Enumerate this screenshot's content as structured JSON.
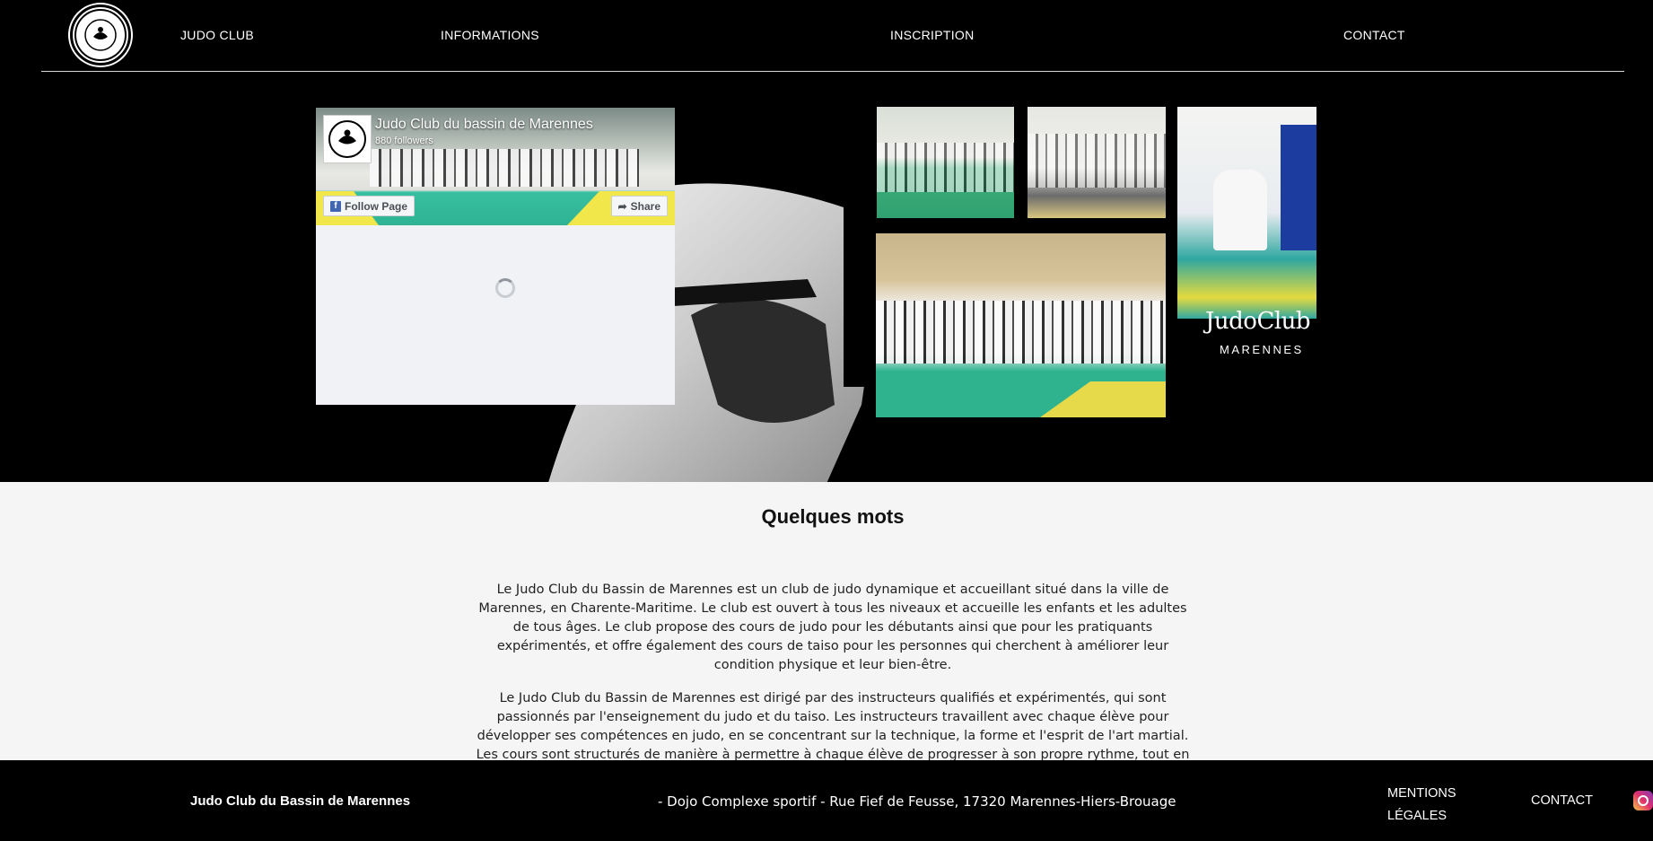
{
  "nav": {
    "items": [
      "JUDO CLUB",
      "INFORMATIONS",
      "INSCRIPTION",
      "CONTACT"
    ]
  },
  "facebook": {
    "page_name": "Judo Club du bassin de Marennes",
    "followers": "880 followers",
    "follow_label": "Follow Page",
    "share_label": "Share"
  },
  "brand": {
    "name": "JudoClub",
    "sub": "MARENNES"
  },
  "about": {
    "title": "Quelques mots",
    "paragraphs": [
      "Le Judo Club du Bassin de Marennes est un club de judo dynamique et accueillant situé dans la ville de Marennes, en Charente-Maritime. Le club est ouvert à tous les niveaux et accueille les enfants et les adultes de tous âges. Le club propose des cours de judo pour les débutants ainsi que pour les pratiquants expérimentés, et offre également des cours de taiso pour les personnes qui cherchent à améliorer leur condition physique et leur bien-être.",
      "Le Judo Club du Bassin de Marennes est dirigé par des instructeurs qualifiés et expérimentés, qui sont passionnés par l'enseignement du judo et du taiso. Les instructeurs travaillent avec chaque élève pour développer ses compétences en judo, en se concentrant sur la technique, la forme et l'esprit de l'art martial. Les cours sont structurés de manière à permettre à chaque élève de progresser à son propre rythme, tout en travaillant en"
    ]
  },
  "footer": {
    "club_name": "Judo Club du Bassin de Marennes",
    "address": "- Dojo Complexe sportif - Rue Fief de Feusse, 17320 Marennes-Hiers-Brouage",
    "mentions": "MENTIONS LÉGALES",
    "contact": "CONTACT"
  },
  "icons": [
    "club-logo-icon",
    "facebook-icon",
    "share-icon",
    "loading-spinner-icon",
    "instagram-icon"
  ]
}
